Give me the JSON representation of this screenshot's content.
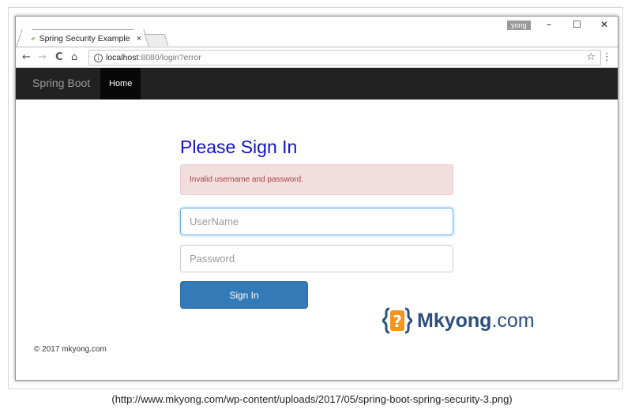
{
  "browser": {
    "tab_title": "Spring Security Example",
    "tab_close": "×",
    "user_badge": "yong",
    "window_controls": {
      "minimize": "–",
      "maximize": "☐",
      "close": "✕"
    },
    "url_host": "localhost",
    "url_rest": ":8080/login?error",
    "icons": [
      "back-icon",
      "forward-icon",
      "reload-icon",
      "home-icon",
      "info-icon",
      "star-icon",
      "menu-icon",
      "leaf-icon"
    ]
  },
  "navbar": {
    "brand": "Spring Boot",
    "home": "Home"
  },
  "login": {
    "heading": "Please Sign In",
    "error": "Invalid username and password.",
    "username_placeholder": "UserName",
    "password_placeholder": "Password",
    "submit": "Sign In"
  },
  "footer": {
    "copyright": "© 2017 mkyong.com"
  },
  "watermark": {
    "name": "Mkyong",
    "tld": ".com"
  },
  "caption": "(http://www.mkyong.com/wp-content/uploads/2017/05/spring-boot-spring-security-3.png)",
  "colors": {
    "navbar_bg": "#222222",
    "heading": "#1111cc",
    "alert_bg": "#f2dede",
    "alert_text": "#a94442",
    "primary_button": "#337ab7",
    "logo_orange": "#f7931e",
    "logo_blue": "#2c4f7c"
  }
}
